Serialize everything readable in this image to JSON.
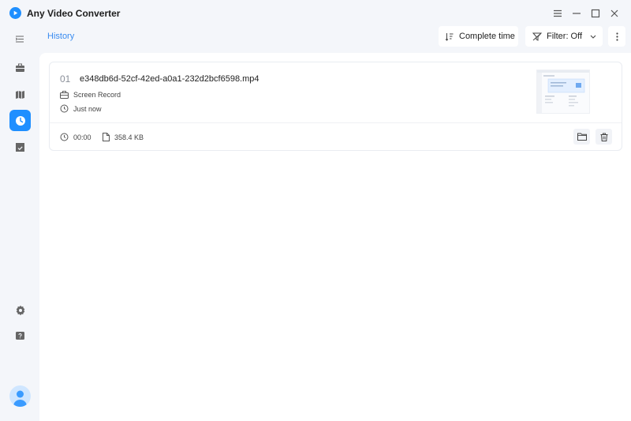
{
  "app": {
    "title": "Any Video Converter"
  },
  "header": {
    "breadcrumb": "History",
    "sort_label": "Complete time",
    "filter_label": "Filter: Off"
  },
  "sidebar": {
    "items": [
      {
        "icon": "toolbox-icon",
        "active": false
      },
      {
        "icon": "book-icon",
        "active": false
      },
      {
        "icon": "clock-icon",
        "active": true
      },
      {
        "icon": "calendar-check-icon",
        "active": false
      }
    ],
    "bottom": [
      {
        "icon": "gear-icon"
      },
      {
        "icon": "help-icon"
      }
    ]
  },
  "history": [
    {
      "index": "01",
      "filename": "e348db6d-52cf-42ed-a0a1-232d2bcf6598.mp4",
      "source": "Screen Record",
      "time": "Just now",
      "duration": "00:00",
      "size": "358.4 KB"
    }
  ],
  "colors": {
    "accent": "#1f8fff",
    "background": "#f4f6fa"
  }
}
